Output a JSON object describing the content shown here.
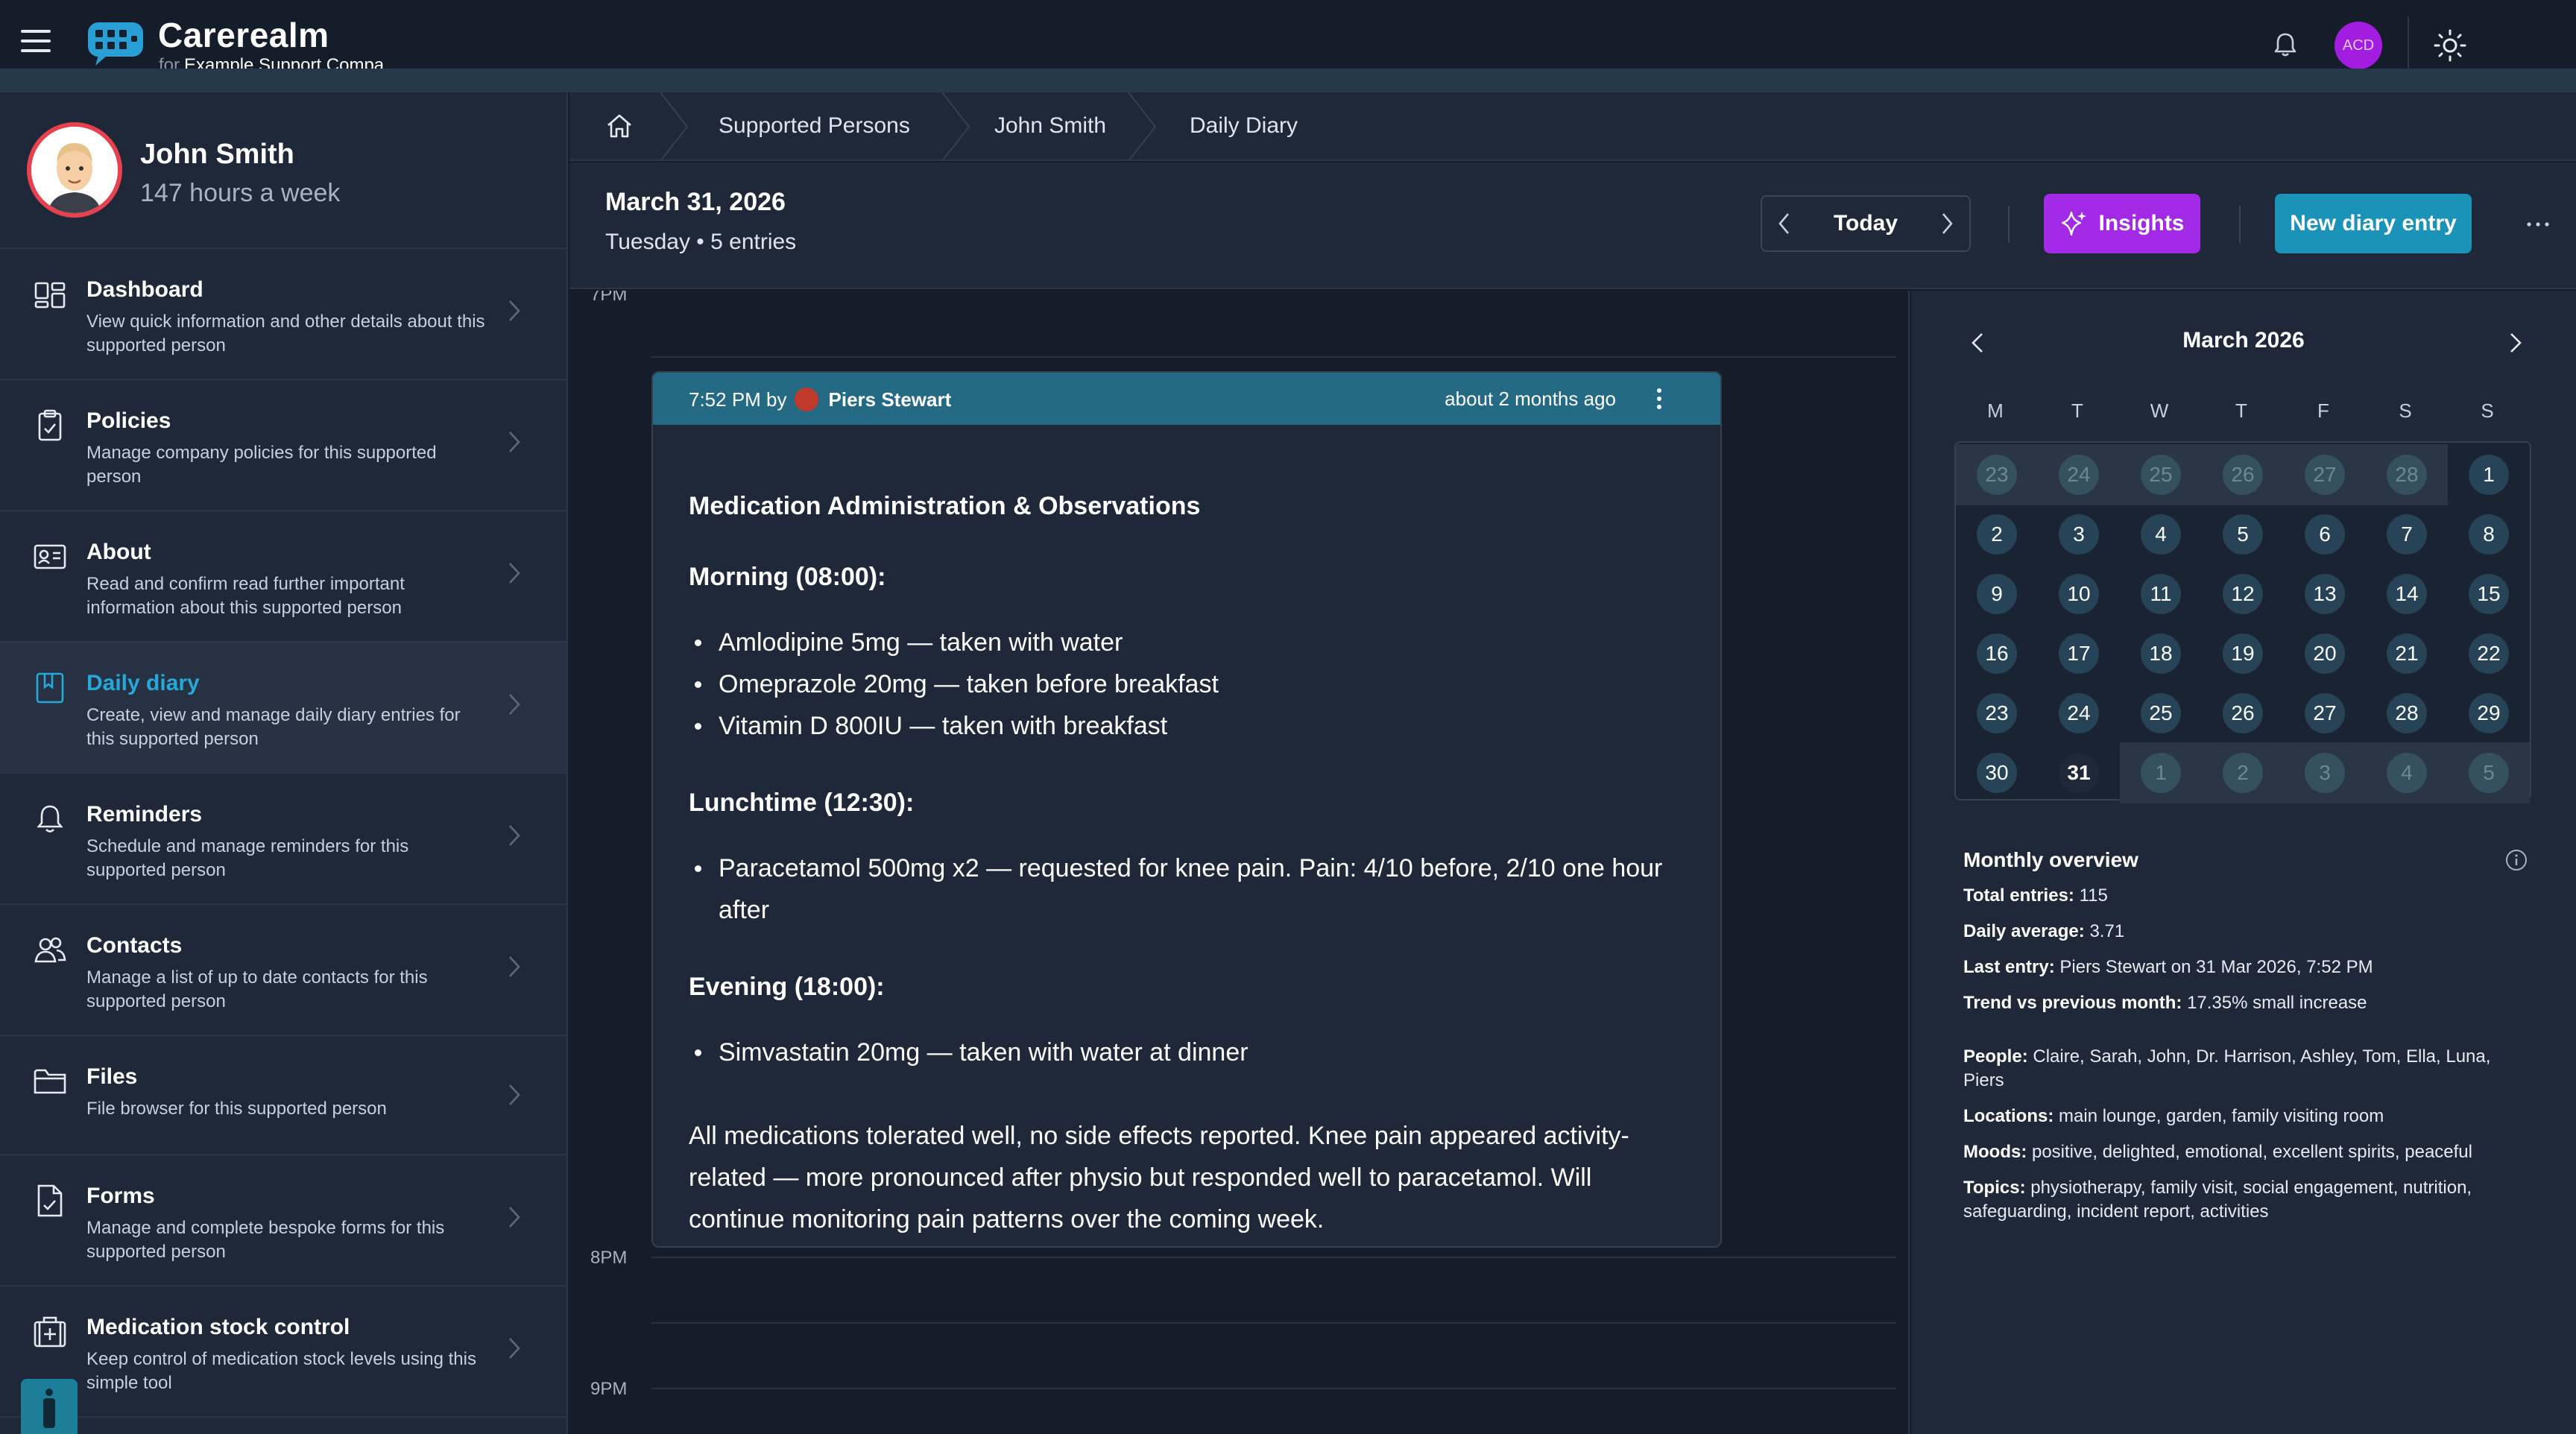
{
  "app": {
    "brand_name": "Carerealm",
    "brand_for": "for",
    "company": "Example Support Compa...",
    "user_initials": "ACD"
  },
  "profile": {
    "name": "John Smith",
    "hours": "147 hours a week"
  },
  "sidebar": {
    "items": [
      {
        "title": "Dashboard",
        "desc": "View quick information and other details about this supported person",
        "icon": "dashboard-icon"
      },
      {
        "title": "Policies",
        "desc": "Manage company policies for this supported person",
        "icon": "clipboard-icon"
      },
      {
        "title": "About",
        "desc": "Read and confirm read further important information about this supported person",
        "icon": "id-card-icon"
      },
      {
        "title": "Daily diary",
        "desc": "Create, view and manage daily diary entries for this supported person",
        "icon": "book-icon",
        "active": true
      },
      {
        "title": "Reminders",
        "desc": "Schedule and manage reminders for this supported person",
        "icon": "bell-icon"
      },
      {
        "title": "Contacts",
        "desc": "Manage a list of up to date contacts for this supported person",
        "icon": "users-icon"
      },
      {
        "title": "Files",
        "desc": "File browser for this supported person",
        "icon": "folder-icon"
      },
      {
        "title": "Forms",
        "desc": "Manage and complete bespoke forms for this supported person",
        "icon": "form-icon"
      },
      {
        "title": "Medication stock control",
        "desc": "Keep control of medication stock levels using this simple tool",
        "icon": "medical-kit-icon"
      }
    ]
  },
  "breadcrumb": {
    "items": [
      "Supported Persons",
      "John Smith",
      "Daily Diary"
    ]
  },
  "header": {
    "date": "March 31, 2026",
    "subtitle": "Tuesday • 5 entries",
    "today_label": "Today",
    "insights_label": "Insights",
    "new_entry_label": "New diary entry"
  },
  "timeline": {
    "labels": [
      "7PM",
      "8PM",
      "9PM"
    ]
  },
  "entry": {
    "time_by": "7:52 PM by",
    "author": "Piers Stewart",
    "ago": "about 2 months ago",
    "title": "Medication Administration & Observations",
    "morning_heading": "Morning (08:00):",
    "morning_items": [
      "Amlodipine 5mg — taken with water",
      "Omeprazole 20mg — taken before breakfast",
      "Vitamin D 800IU — taken with breakfast"
    ],
    "lunch_heading": "Lunchtime (12:30):",
    "lunch_items": [
      "Paracetamol 500mg x2 — requested for knee pain. Pain: 4/10 before, 2/10 one hour after"
    ],
    "evening_heading": "Evening (18:00):",
    "evening_items": [
      "Simvastatin 20mg — taken with water at dinner"
    ],
    "summary": "All medications tolerated well, no side effects reported. Knee pain appeared activity-related — more pronounced after physio but responded well to paracetamol. Will continue monitoring pain patterns over the coming week."
  },
  "calendar": {
    "title": "March 2026",
    "weekdays": [
      "M",
      "T",
      "W",
      "T",
      "F",
      "S",
      "S"
    ],
    "days": [
      [
        "23",
        "24",
        "25",
        "26",
        "27",
        "28",
        "1"
      ],
      [
        "2",
        "3",
        "4",
        "5",
        "6",
        "7",
        "8"
      ],
      [
        "9",
        "10",
        "11",
        "12",
        "13",
        "14",
        "15"
      ],
      [
        "16",
        "17",
        "18",
        "19",
        "20",
        "21",
        "22"
      ],
      [
        "23",
        "24",
        "25",
        "26",
        "27",
        "28",
        "29"
      ],
      [
        "30",
        "31",
        "1",
        "2",
        "3",
        "4",
        "5"
      ]
    ],
    "today": "31"
  },
  "overview": {
    "title": "Monthly overview",
    "total_label": "Total entries:",
    "total_value": "115",
    "avg_label": "Daily average:",
    "avg_value": "3.71",
    "last_label": "Last entry:",
    "last_value": "Piers Stewart on 31 Mar 2026, 7:52 PM",
    "trend_label": "Trend vs previous month:",
    "trend_value": "17.35% small increase",
    "people_label": "People:",
    "people_value": "Claire, Sarah, John, Dr. Harrison, Ashley, Tom, Ella, Luna, Piers",
    "locations_label": "Locations:",
    "locations_value": "main lounge, garden, family visiting room",
    "moods_label": "Moods:",
    "moods_value": "positive, delighted, emotional, excellent spirits, peaceful",
    "topics_label": "Topics:",
    "topics_value": "physiotherapy, family visit, social engagement, nutrition, safeguarding, incident report, activities"
  },
  "colors": {
    "accent_teal": "#1b93b8",
    "insights_purple": "#a22ae6",
    "entry_header": "#246a84",
    "avatar_ring": "#e8414e"
  }
}
